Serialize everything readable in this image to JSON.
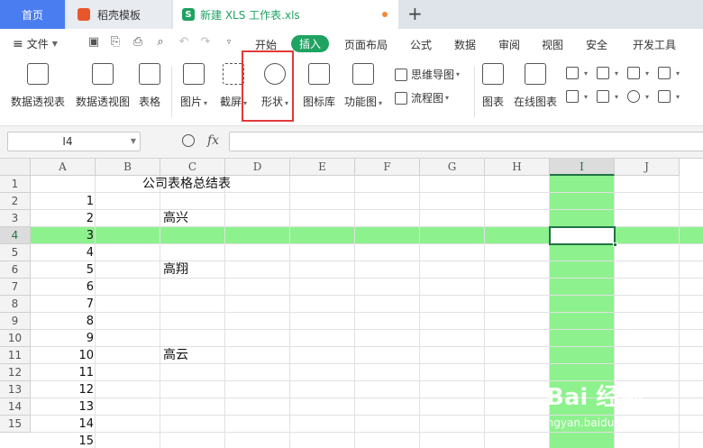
{
  "titlebar": {
    "home_tab": "首页",
    "template_tab": "稻壳模板",
    "doc_tab": "新建 XLS 工作表.xls",
    "doc_icon": "S",
    "new_tab": "+"
  },
  "menubar": {
    "file_label": "文件",
    "tabs": [
      "开始",
      "插入",
      "页面布局",
      "公式",
      "数据",
      "审阅",
      "视图",
      "安全",
      "开发工具"
    ],
    "active_tab": "插入"
  },
  "ribbon": {
    "buttons": [
      "数据透视表",
      "数据透视图",
      "表格",
      "图片",
      "截屏",
      "形状",
      "图标库",
      "功能图",
      "图表",
      "在线图表"
    ],
    "small_buttons": [
      "思维导图",
      "流程图"
    ],
    "highlighted": "形状"
  },
  "formula_bar": {
    "name_box": "I4",
    "fx_label": "fx",
    "value": ""
  },
  "grid": {
    "columns": [
      "A",
      "B",
      "C",
      "D",
      "E",
      "F",
      "G",
      "H",
      "I",
      "J"
    ],
    "rows": [
      "1",
      "2",
      "3",
      "4",
      "5",
      "6",
      "7",
      "8",
      "9",
      "10",
      "11",
      "12",
      "13",
      "14",
      "15"
    ],
    "selected_column": "I",
    "selected_row": "4",
    "title_cell": "公司表格总结表",
    "a_values": [
      "1",
      "2",
      "3",
      "4",
      "5",
      "6",
      "7",
      "8",
      "9",
      "10",
      "11",
      "12",
      "13",
      "14",
      "15"
    ],
    "c_values": {
      "row3": "高兴",
      "row6": "高翔",
      "row11": "高云"
    },
    "highlight_color": "#8df28d",
    "accent_color": "#217346"
  },
  "watermark": {
    "line1": "Bai  经验",
    "line2": "jingyan.baidu.com"
  }
}
